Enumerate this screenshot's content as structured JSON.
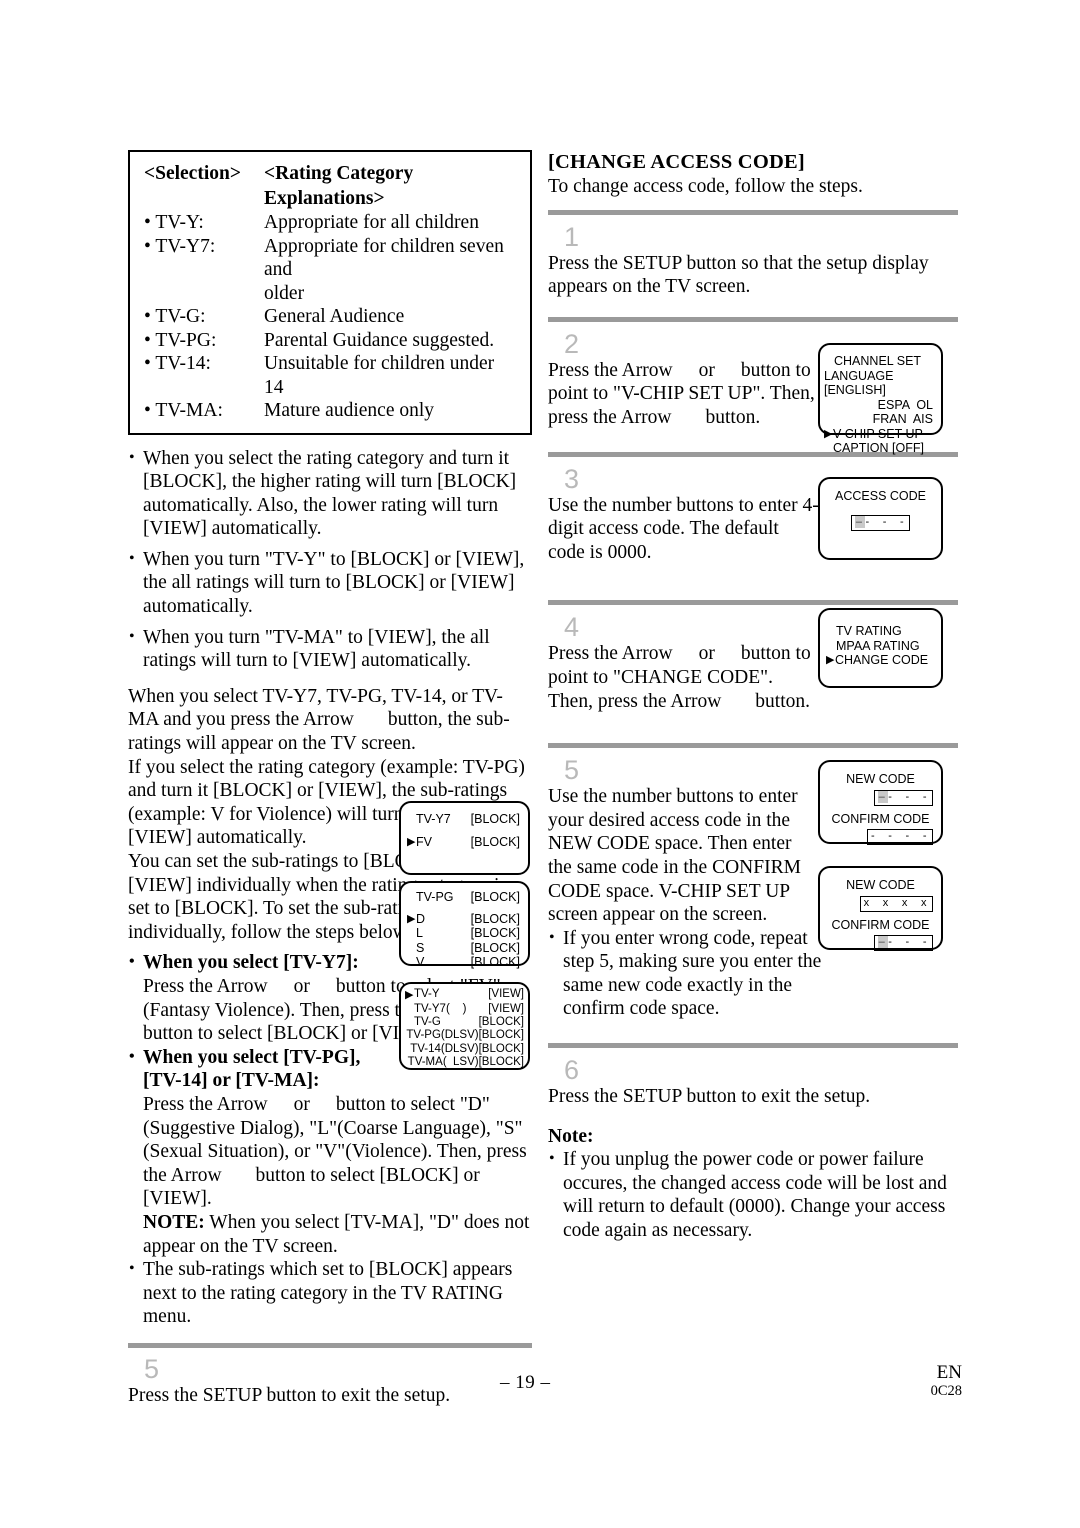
{
  "document": {
    "page_number": "– 19 –",
    "footer_lang": "EN",
    "footer_code": "0C28"
  },
  "left_column": {
    "rating_table": {
      "header_selection": "<Selection>",
      "header_explanation": "<Rating Category Explanations>",
      "rows": [
        {
          "selection": "• TV-Y:",
          "explanation": "Appropriate for all children"
        },
        {
          "selection": "• TV-Y7:",
          "explanation": "Appropriate for children seven and",
          "continuation": "older"
        },
        {
          "selection": "• TV-G:",
          "explanation": "General Audience"
        },
        {
          "selection": "• TV-PG:",
          "explanation": "Parental Guidance suggested."
        },
        {
          "selection": "• TV-14:",
          "explanation": "Unsuitable for children under 14"
        },
        {
          "selection": "• TV-MA:",
          "explanation": "Mature audience only"
        }
      ]
    },
    "bullets": [
      "When you select the rating category and turn it [BLOCK], the higher rating will turn [BLOCK] automatically. Also, the lower rating will turn [VIEW] automatically.",
      "When you turn \"TV-Y\" to [BLOCK] or [VIEW], the all ratings will turn to [BLOCK] or [VIEW] automatically.",
      "When you turn \"TV-MA\" to [VIEW], the all ratings will turn to [VIEW] automatically."
    ],
    "paragraph_1_a": "When you select TV-Y7, TV-PG, TV-14, or TV-MA and you press the Arrow",
    "paragraph_1_b": "button, the sub-ratings will appear on the TV screen.",
    "paragraph_2": "If you select the rating category (example: TV-PG) and turn it [BLOCK] or [VIEW], the sub-ratings (example: V for Violence) will turn [BLOCK] or [VIEW] automatically.",
    "paragraph_3": "You can set the sub-ratings to [BLOCK] or [VIEW] individually when the rating category is set to [BLOCK]. To set the sub-ratings individually, follow the steps below.",
    "tvy7_heading": "When you select [TV-Y7]:",
    "tvy7_text_a": "Press the Arrow",
    "tvy7_text_b": "or",
    "tvy7_text_c": "button to select \"FV\" (Fantasy Violence). Then, press the Arrow",
    "tvy7_text_d": "button to select [BLOCK] or [VIEW].",
    "tvpg_heading_line1": "When you select [TV-PG],",
    "tvpg_heading_line2": "[TV-14] or [TV-MA]:",
    "tvpg_text_a": "Press the Arrow",
    "tvpg_text_b": "or",
    "tvpg_text_c": "button to select \"D\"(Suggestive Dialog), \"L\"(Coarse Language), \"S\"(Sexual Situation), or \"V\"(Violence). Then, press the Arrow",
    "tvpg_text_d": "button to select [BLOCK] or [VIEW].",
    "note_label": "NOTE:",
    "note_text": " When you select [TV-MA], \"D\" does not appear on the TV screen.",
    "final_bullet": "The sub-ratings which set to [BLOCK] appears next to the rating category in the TV RATING menu.",
    "step5_number": "5",
    "step5_text": "Press the SETUP button to exit the setup.",
    "screens": {
      "tvy7": {
        "rows": [
          {
            "arrow": "",
            "label": "TV-Y7",
            "value": "[BLOCK]"
          },
          {
            "arrow": "▶",
            "label": "FV",
            "value": "[BLOCK]"
          }
        ]
      },
      "tvpg": {
        "rows": [
          {
            "arrow": "",
            "label": "TV-PG",
            "value": "[BLOCK]"
          },
          {
            "arrow": "▶",
            "label": "D",
            "value": "[BLOCK]"
          },
          {
            "arrow": "",
            "label": "L",
            "value": "[BLOCK]"
          },
          {
            "arrow": "",
            "label": "S",
            "value": "[BLOCK]"
          },
          {
            "arrow": "",
            "label": "V",
            "value": "[BLOCK]"
          }
        ]
      },
      "tvrating": {
        "rows": [
          {
            "arrow": "▶",
            "label": "TV-Y",
            "sub": "",
            "value": "[VIEW]"
          },
          {
            "arrow": "",
            "label": "TV-Y7",
            "sub": "(    )",
            "value": "[VIEW]"
          },
          {
            "arrow": "",
            "label": "TV-G",
            "sub": "",
            "value": "[BLOCK]"
          },
          {
            "arrow": "",
            "label": "TV-PG",
            "sub": "(DLSV)",
            "value": "[BLOCK]"
          },
          {
            "arrow": "",
            "label": "TV-14",
            "sub": "(DLSV)",
            "value": "[BLOCK]"
          },
          {
            "arrow": "",
            "label": "TV-MA",
            "sub": "(  LSV)",
            "value": "[BLOCK]"
          }
        ]
      }
    }
  },
  "right_column": {
    "title": "[CHANGE ACCESS CODE]",
    "intro": "To change access code, follow the steps.",
    "steps": [
      {
        "number": "1",
        "text": "Press the SETUP button so that the setup display appears on the TV screen."
      },
      {
        "number": "2",
        "text_a": "Press the Arrow",
        "text_b": "or",
        "text_c": "button to point to \"V-CHIP SET UP\". Then, press the Arrow",
        "text_d": "button."
      },
      {
        "number": "3",
        "text": "Use the number buttons to enter 4-digit access code. The default code is 0000."
      },
      {
        "number": "4",
        "text_a": "Press the Arrow",
        "text_b": "or",
        "text_c": "button to point to \"CHANGE CODE\". Then, press the Arrow",
        "text_d": "button."
      },
      {
        "number": "5",
        "text": "Use the number buttons to enter your desired access code in the NEW CODE space. Then enter the same code in the CONFIRM CODE space. V-CHIP SET UP screen appear on the screen.",
        "bullet": "If you enter wrong code, repeat step 5, making sure you enter the same new code exactly in the confirm code space."
      },
      {
        "number": "6",
        "text": "Press the SETUP button to exit the setup."
      }
    ],
    "note_heading": "Note:",
    "note_bullet": "If you unplug the power code or power failure occures, the changed access code will be lost and will return to default (0000). Change your access code again as necessary.",
    "screens": {
      "setup_menu": {
        "rows": [
          {
            "arrow": "",
            "text": "CHANNEL SET",
            "align": "left"
          },
          {
            "arrow": "",
            "text": "LANGUAGE [ENGLISH]",
            "align": "left"
          },
          {
            "arrow": "",
            "text": "ESPA  OL",
            "align": "right"
          },
          {
            "arrow": "",
            "text": "FRAN  AIS",
            "align": "right"
          },
          {
            "arrow": "▶",
            "text": "V-CHIP SET UP",
            "align": "left"
          },
          {
            "arrow": "",
            "text": "CAPTION [OFF]",
            "align": "left"
          }
        ]
      },
      "access_code": {
        "title": "ACCESS CODE",
        "cursor": "–",
        "dashes": "-  -  -"
      },
      "vchip_menu": {
        "rows": [
          {
            "arrow": "",
            "text": "TV RATING"
          },
          {
            "arrow": "",
            "text": "MPAA RATING"
          },
          {
            "arrow": "▶",
            "text": "CHANGE CODE"
          }
        ]
      },
      "new_code_empty": {
        "new_label": "NEW CODE",
        "new_cursor": "–",
        "new_dashes": "-  -  -",
        "confirm_label": "CONFIRM CODE",
        "confirm_value": "-  -  -  -"
      },
      "new_code_filled": {
        "new_label": "NEW CODE",
        "new_value": "x  x  x  x",
        "confirm_label": "CONFIRM CODE",
        "confirm_cursor": "–",
        "confirm_dashes": "-  -  -"
      }
    }
  }
}
